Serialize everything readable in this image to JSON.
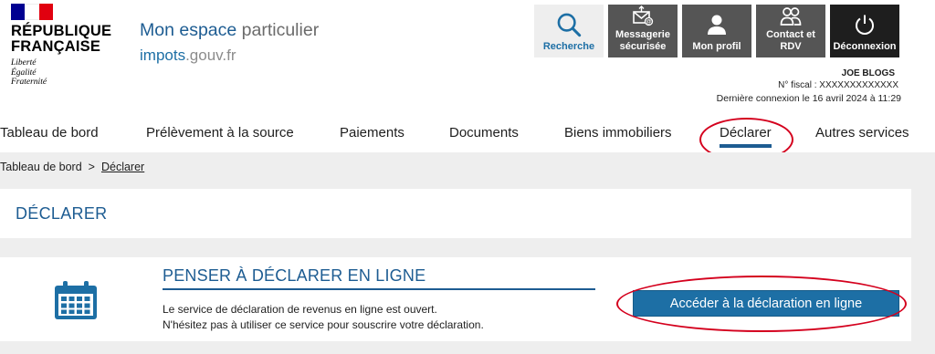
{
  "logo": {
    "title_line1": "RÉPUBLIQUE",
    "title_line2": "FRANÇAISE",
    "motto_1": "Liberté",
    "motto_2": "Égalité",
    "motto_3": "Fraternité"
  },
  "site": {
    "espace_strong": "Mon espace",
    "espace_light": "particulier",
    "impots": "impots",
    "gouv": ".gouv.fr"
  },
  "toolbar": {
    "search_label": "Recherche",
    "messagerie_line1": "Messagerie",
    "messagerie_line2": "sécurisée",
    "profil_label": "Mon profil",
    "contact_line1": "Contact et",
    "contact_line2": "RDV",
    "deconnexion_label": "Déconnexion"
  },
  "user": {
    "name": "JOE BLOGS",
    "fiscal": "N° fiscal :   XXXXXXXXXXXXX",
    "last_connection": "Dernière connexion le 16 avril 2024 à 11:29"
  },
  "nav": {
    "items": [
      {
        "label": "Tableau de bord"
      },
      {
        "label": "Prélèvement à la source"
      },
      {
        "label": "Paiements"
      },
      {
        "label": "Documents"
      },
      {
        "label": "Biens immobiliers"
      },
      {
        "label": "Déclarer"
      },
      {
        "label": "Autres services"
      }
    ],
    "active": "Déclarer"
  },
  "breadcrumb": {
    "home": "Tableau de bord",
    "separator": ">",
    "current": "Déclarer"
  },
  "page": {
    "title": "DÉCLARER"
  },
  "card": {
    "title": "PENSER À DÉCLARER EN LIGNE",
    "text_1": "Le service de déclaration de revenus en ligne est ouvert.",
    "text_2": "N'hésitez pas à utiliser ce service pour souscrire votre déclaration.",
    "cta_label": "Accéder à la déclaration en ligne",
    "icon": "calendar-icon"
  },
  "colors": {
    "brand_blue": "#1d5c92",
    "button_blue": "#1d6fa5",
    "annotation_red": "#d4001d",
    "toolbar_gray": "#555555",
    "page_gray": "#eeeeee"
  }
}
